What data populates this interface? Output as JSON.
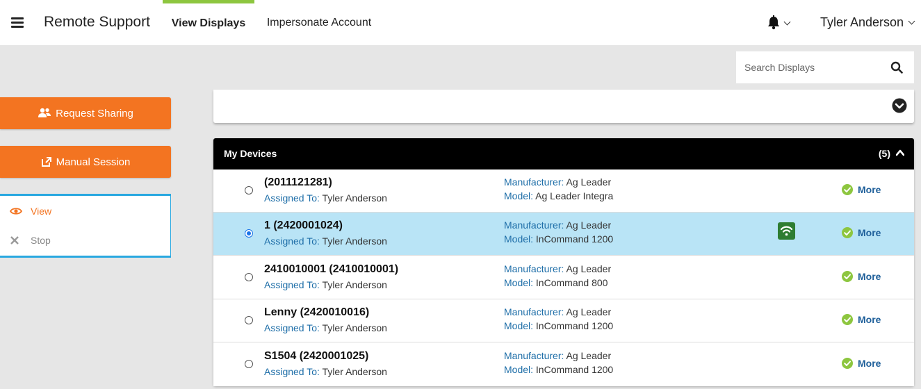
{
  "header": {
    "app_title": "Remote Support",
    "nav_tabs": [
      {
        "label": "View Displays",
        "active": true
      },
      {
        "label": "Impersonate Account",
        "active": false
      }
    ],
    "user_name": "Tyler Anderson"
  },
  "search": {
    "placeholder": "Search Displays",
    "value": ""
  },
  "sidebar": {
    "request_sharing_label": "Request Sharing",
    "manual_session_label": "Manual Session",
    "actions": [
      {
        "label": "View",
        "icon": "eye-icon",
        "color": "#f37421"
      },
      {
        "label": "Stop",
        "icon": "close-icon",
        "color": "#888888"
      }
    ]
  },
  "devices": {
    "title": "My Devices",
    "count": "(5)",
    "assigned_key": "Assigned To:",
    "manufacturer_key": "Manufacturer:",
    "model_key": "Model:",
    "more_label": "More",
    "rows": [
      {
        "name": "(2011121281)",
        "assigned_to": "Tyler Anderson",
        "manufacturer": "Ag Leader",
        "model": "Ag Leader Integra",
        "selected": false,
        "connected": false
      },
      {
        "name": "1 (2420001024)",
        "assigned_to": "Tyler Anderson",
        "manufacturer": "Ag Leader",
        "model": "InCommand 1200",
        "selected": true,
        "connected": true
      },
      {
        "name": "2410010001 (2410010001)",
        "assigned_to": "Tyler Anderson",
        "manufacturer": "Ag Leader",
        "model": "InCommand 800",
        "selected": false,
        "connected": false
      },
      {
        "name": "Lenny (2420010016)",
        "assigned_to": "Tyler Anderson",
        "manufacturer": "Ag Leader",
        "model": "InCommand 1200",
        "selected": false,
        "connected": false
      },
      {
        "name": "S1504 (2420001025)",
        "assigned_to": "Tyler Anderson",
        "manufacturer": "Ag Leader",
        "model": "InCommand 1200",
        "selected": false,
        "connected": false
      }
    ]
  },
  "colors": {
    "accent_orange": "#f37421",
    "nav_active_bar": "#8dc63f",
    "selected_row": "#b9e4f6",
    "panel_border": "#29a8e0",
    "link_blue": "#1e6ea8",
    "wifi_green": "#2e7d32",
    "check_green": "#8dc63f"
  }
}
